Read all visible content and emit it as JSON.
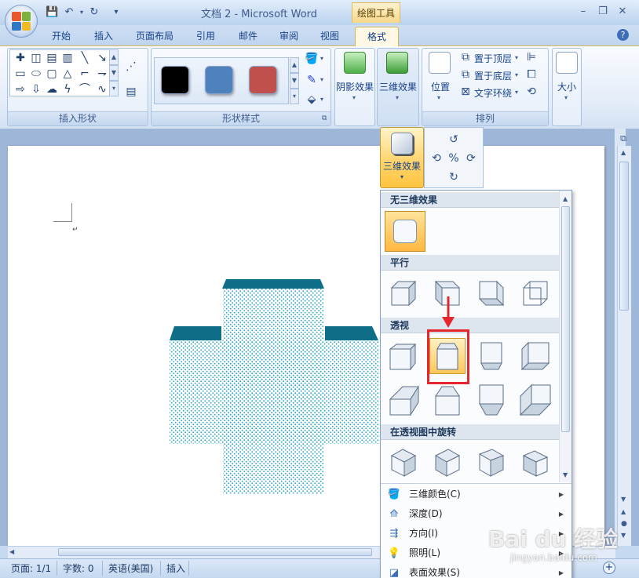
{
  "window": {
    "title": "文档 2 - Microsoft Word",
    "contextual_tab_label": "绘图工具"
  },
  "tabs": [
    "开始",
    "插入",
    "页面布局",
    "引用",
    "邮件",
    "审阅",
    "视图"
  ],
  "active_tab": "格式",
  "ribbon": {
    "insert_shapes_label": "插入形状",
    "shape_styles_label": "形状样式",
    "arrange_label": "排列",
    "shadow_effects": "阴影效果",
    "three_d_effects": "三维效果",
    "position": "位置",
    "bring_to_front": "置于顶层",
    "send_to_back": "置于底层",
    "text_wrapping": "文字环绕",
    "size": "大小",
    "swatch_colors": [
      "#000000",
      "#4f81bd",
      "#c0504d"
    ]
  },
  "dropdown_button_label": "三维效果",
  "menu": {
    "sections": [
      "无三维效果",
      "平行",
      "透视",
      "在透视图中旋转"
    ],
    "items": [
      {
        "label": "三维颜色(C)",
        "icon": "paint-bucket-icon"
      },
      {
        "label": "深度(D)",
        "icon": "depth-icon"
      },
      {
        "label": "方向(I)",
        "icon": "direction-icon"
      },
      {
        "label": "照明(L)",
        "icon": "lighting-icon"
      },
      {
        "label": "表面效果(S)",
        "icon": "surface-icon"
      }
    ]
  },
  "statusbar": {
    "page": "页面: 1/1",
    "words": "字数: 0",
    "language": "英语(美国)",
    "mode": "插入"
  },
  "watermark": {
    "text": "Bai du 经验",
    "sub": "jingyan.baidu.com"
  },
  "colors": {
    "shape_top": "#0e6d87",
    "shape_pattern": "#29a6c5",
    "highlight": "#e6262d"
  }
}
